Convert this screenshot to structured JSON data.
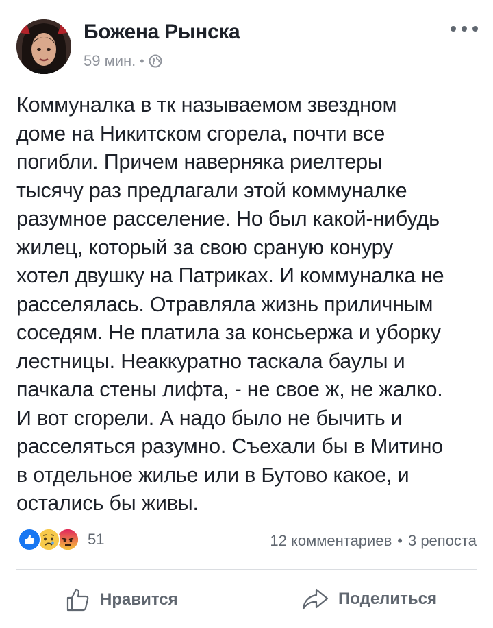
{
  "post": {
    "author": "Божена Рынска",
    "time": "59 мин.",
    "separator": "•",
    "privacy_icon": "globe-icon",
    "more_icon": "more-icon",
    "text": "Коммуналка в тк называемом звездном\nдоме на Никитском сгорела, почти все\nпогибли. Причем наверняка риелтеры\nтысячу раз предлагали этой коммуналке\nразумное расселение. Но был какой-нибудь\nжилец, который за свою сраную конуру\nхотел двушку на Патриках. И коммуналка не\nрасселялась. Отравляла жизнь приличным\nсоседям. Не платила за консьержа и уборку\nлестницы. Неаккуратно таскала баулы и\nпачкала стены лифта, - не свое ж, не жалко.\nИ вот сгорели. А надо было не бычить и\nрасселяться разумно. Съехали бы в Митино\nв отдельное жилье или в Бутово какое, и\nостались бы живы."
  },
  "reactions": {
    "icons": [
      "like-reaction-icon",
      "sad-reaction-icon",
      "angry-reaction-icon"
    ],
    "count": "51"
  },
  "stats": {
    "comments": "12 комментариев",
    "separator": "•",
    "shares": "3 репоста"
  },
  "actions": {
    "like_label": "Нравится",
    "share_label": "Поделиться"
  },
  "colors": {
    "text": "#1d2129",
    "secondary": "#606770",
    "meta": "#90949c",
    "like_blue": "#1877f2",
    "sad_yellow": "#f7c94a",
    "angry_red": "#e9710f",
    "divider": "#dadde1"
  }
}
